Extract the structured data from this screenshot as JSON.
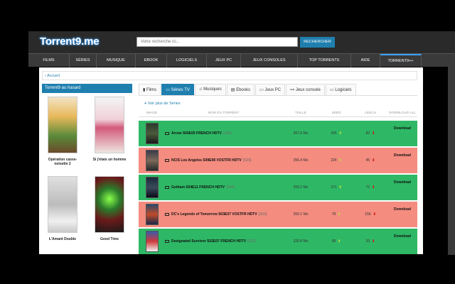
{
  "header": {
    "logo": "Torrent9.me",
    "search_placeholder": "Votre recherche ici...",
    "search_button": "RECHERCHER"
  },
  "nav": [
    {
      "label": "FILMS"
    },
    {
      "label": "SÉRIES"
    },
    {
      "label": "MUSIQUE"
    },
    {
      "label": "EBOOK"
    },
    {
      "label": "LOGICIELS"
    },
    {
      "label": "JEUX PC"
    },
    {
      "label": "JEUX CONSOLES"
    },
    {
      "label": "TOP TORRENTS"
    },
    {
      "label": "AIDE"
    },
    {
      "label": "TORRENT9++"
    }
  ],
  "breadcrumb": "Accueil",
  "sidebar": {
    "title": "Torrent9 au hasard",
    "movies": [
      {
        "title": "Opération casse-noisette 2"
      },
      {
        "title": "Si j'étais un homme"
      },
      {
        "title": "L'Amant Double"
      },
      {
        "title": "Good Time"
      }
    ]
  },
  "tabs": [
    {
      "label": "Films",
      "icon": "film-icon"
    },
    {
      "label": "Séries TV",
      "icon": "tv-icon"
    },
    {
      "label": "Musiques",
      "icon": "music-icon"
    },
    {
      "label": "Ebooks",
      "icon": "book-icon"
    },
    {
      "label": "Jeux PC",
      "icon": "monitor-icon"
    },
    {
      "label": "Jeux console",
      "icon": "gamepad-icon"
    },
    {
      "label": "Logiciels",
      "icon": "laptop-icon"
    }
  ],
  "more_link": "Voir plus de Séries",
  "table": {
    "headers": [
      "IMAGE",
      "NOM DU TORRENT",
      "TAILLE",
      "SEED",
      "LEECH",
      "DOWNLOAD ALL"
    ],
    "rows": [
      {
        "name": "Arrow S06E05 FRENCH HDTV",
        "tag": "[S06]",
        "size": "367.6 Mo",
        "seed": "425",
        "leech": "82",
        "download": "Download",
        "status": "green"
      },
      {
        "name": "NCIS Los Angeles S09E08 VOSTFR HDTV",
        "tag": "[S09]",
        "size": "356.4 Mo",
        "seed": "224",
        "leech": "45",
        "download": "Download",
        "status": "red"
      },
      {
        "name": "Gotham S04E11 FRENCH HDTV",
        "tag": "[S04]",
        "size": "359.2 Mo",
        "seed": "371",
        "leech": "72",
        "download": "Download",
        "status": "green"
      },
      {
        "name": "DC's Legends of Tomorrow S03E07 VOSTFR HDTV",
        "tag": "[S03]",
        "size": "350.1 Mo",
        "seed": "78",
        "leech": "156",
        "download": "Download",
        "status": "red"
      },
      {
        "name": "Designated Survivor S02E07 FRENCH HDTV",
        "tag": "[S02]",
        "size": "330.8 Mo",
        "seed": "98",
        "leech": "33",
        "download": "Download",
        "status": "green"
      }
    ]
  },
  "colors": {
    "accent": "#1f7fae",
    "row_green": "#2eb865",
    "row_red": "#f48c7f"
  }
}
